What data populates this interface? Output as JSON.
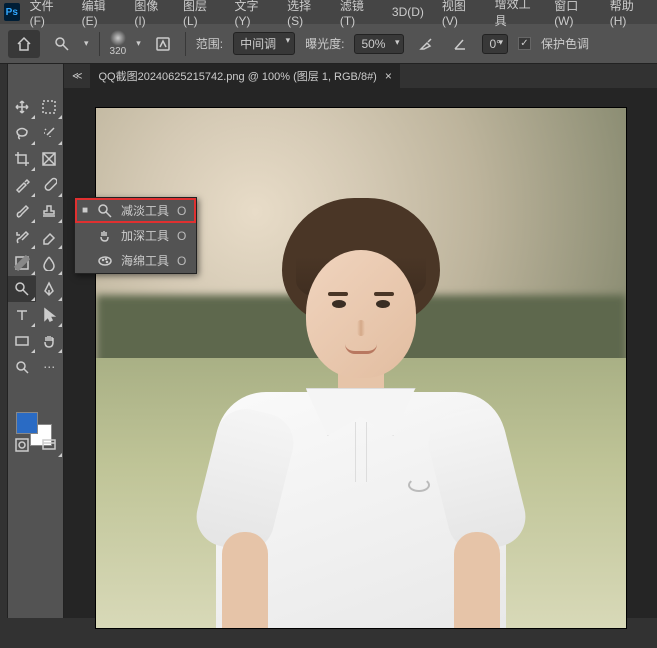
{
  "app": {
    "logo": "Ps"
  },
  "menu": {
    "file": "文件(F)",
    "edit": "编辑(E)",
    "image": "图像(I)",
    "layer": "图层(L)",
    "type": "文字(Y)",
    "select": "选择(S)",
    "filter": "滤镜(T)",
    "threeD": "3D(D)",
    "view": "视图(V)",
    "plugins": "增效工具",
    "window": "窗口(W)",
    "help": "帮助(H)"
  },
  "options": {
    "brush_size": "320",
    "range_label": "范围:",
    "range_value": "中间调",
    "exposure_label": "曝光度:",
    "exposure_value": "50%",
    "angle_value": "0°",
    "protect_label": "保护色调",
    "protect_checked": "✓"
  },
  "tab": {
    "title": "QQ截图20240625215742.png @ 100% (图层 1, RGB/8#)",
    "close": "×"
  },
  "flyout": {
    "items": [
      {
        "label": "减淡工具",
        "key": "O",
        "selected": true
      },
      {
        "label": "加深工具",
        "key": "O",
        "selected": false
      },
      {
        "label": "海绵工具",
        "key": "O",
        "selected": false
      }
    ]
  },
  "colors": {
    "foreground": "#2a6bc4",
    "background": "#ffffff"
  }
}
